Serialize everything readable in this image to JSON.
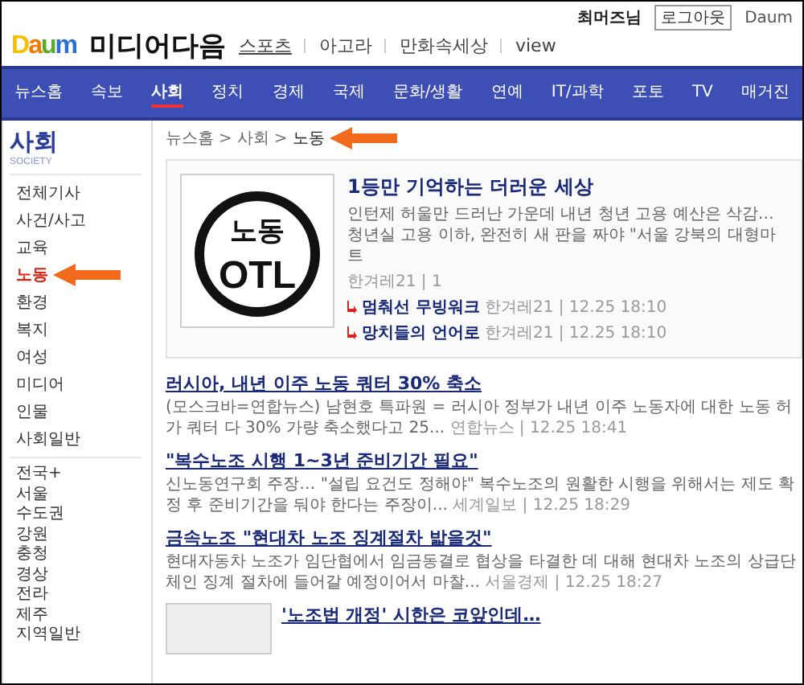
{
  "header": {
    "user": "최머즈님",
    "logout": "로그아웃",
    "home": "Daum",
    "logo": "Daum",
    "site_title": "미디어다음",
    "links": [
      "스포츠",
      "아고라",
      "만화속세상",
      "view"
    ]
  },
  "nav": [
    {
      "label": "뉴스홈",
      "selected": false
    },
    {
      "label": "속보",
      "selected": false
    },
    {
      "label": "사회",
      "selected": true
    },
    {
      "label": "정치",
      "selected": false
    },
    {
      "label": "경제",
      "selected": false
    },
    {
      "label": "국제",
      "selected": false
    },
    {
      "label": "문화/생활",
      "selected": false
    },
    {
      "label": "연예",
      "selected": false
    },
    {
      "label": "IT/과학",
      "selected": false
    },
    {
      "label": "포토",
      "selected": false
    },
    {
      "label": "TV",
      "selected": false
    },
    {
      "label": "매거진",
      "selected": false
    }
  ],
  "sidebar": {
    "title": "사회",
    "subtitle": "SOCIETY",
    "items": [
      {
        "label": "전체기사",
        "selected": false,
        "pointer": false
      },
      {
        "label": "사건/사고",
        "selected": false,
        "pointer": false
      },
      {
        "label": "교육",
        "selected": false,
        "pointer": false
      },
      {
        "label": "노동",
        "selected": true,
        "pointer": true
      },
      {
        "label": "환경",
        "selected": false,
        "pointer": false
      },
      {
        "label": "복지",
        "selected": false,
        "pointer": false
      },
      {
        "label": "여성",
        "selected": false,
        "pointer": false
      },
      {
        "label": "미디어",
        "selected": false,
        "pointer": false
      },
      {
        "label": "인물",
        "selected": false,
        "pointer": false
      },
      {
        "label": "사회일반",
        "selected": false,
        "pointer": false
      }
    ],
    "regions": [
      "전국+",
      "서울",
      "수도권",
      "강원",
      "충청",
      "경상",
      "전라",
      "제주",
      "지역일반"
    ]
  },
  "breadcrumb": {
    "items": [
      "뉴스홈",
      "사회",
      "노동"
    ],
    "separator": ">",
    "pointer": true
  },
  "featured": {
    "logo_text": [
      "노동",
      "OTL"
    ],
    "title": "1등만 기억하는 더러운 세상",
    "summary": "인턴제 허울만 드러난 가운데 내년 청년 고용 예산은 삭감… 청년실 고용 이하, 완전히 새 판을 짜야 \"서울 강북의 대형마트",
    "source": "한겨레21 | 1",
    "related": [
      {
        "title": "멈춰선 무빙워크",
        "source": "한겨레21 | 12.25 18:10"
      },
      {
        "title": "망치들의 언어로",
        "source": "한겨레21 | 12.25 18:10"
      }
    ]
  },
  "articles": [
    {
      "kind": "text",
      "title": "러시아, 내년 이주 노동 쿼터 30% 축소",
      "summary": "(모스크바=연합뉴스) 남현호 특파원 = 러시아 정부가 내년 이주 노동자에 대한 노동 허가 쿼터 다 30% 가량 축소했다고 25...",
      "source": "연합뉴스 | 12.25 18:41"
    },
    {
      "kind": "text",
      "title": "\"복수노조 시행 1~3년 준비기간 필요\"",
      "summary": "신노동연구회 주장… \"설립 요건도 정해야\" 복수노조의 원활한 시행을 위해서는 제도 확정 후 준비기간을 둬야 한다는 주장이...",
      "source": "세계일보 | 12.25 18:29"
    },
    {
      "kind": "text",
      "title": "금속노조 \"현대차 노조 징계절차 밟을것\"",
      "summary": "현대자동차 노조가 임단협에서 임금동결로 협상을 타결한 데 대해 현대차 노조의 상급단체인 징계 절차에 들어갈 예정이어서 마찰...",
      "source": "서울경제 | 12.25 18:27"
    },
    {
      "kind": "thumb",
      "title": "'노조법 개정' 시한은 코앞인데…"
    }
  ]
}
